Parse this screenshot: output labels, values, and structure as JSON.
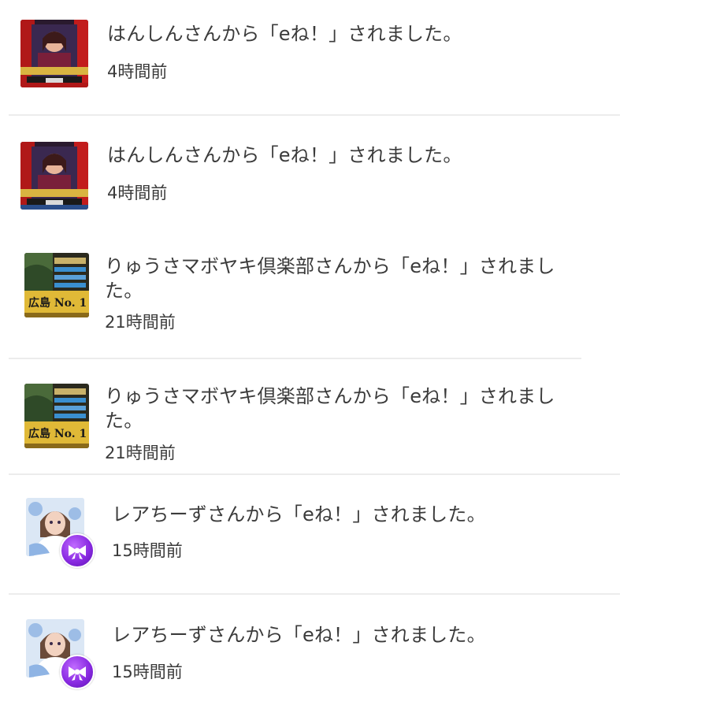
{
  "notifications": [
    {
      "message": "はんしんさんから「eね！」されました。",
      "time": "4時間前",
      "avatar_icon": "character-card-red-icon"
    },
    {
      "message": "はんしんさんから「eね！」されました。",
      "time": "4時間前",
      "avatar_icon": "character-card-red-icon"
    },
    {
      "message": "りゅうさマボヤキ倶楽部さんから「eね！」されました。",
      "time": "21時間前",
      "avatar_icon": "hiroshima-no1-card-icon",
      "avatar_text": "広島 No. 1"
    },
    {
      "message": "りゅうさマボヤキ倶楽部さんから「eね！」されました。",
      "time": "21時間前",
      "avatar_icon": "hiroshima-no1-card-icon",
      "avatar_text": "広島 No. 1"
    },
    {
      "message": "レアちーずさんから「eね！」されました。",
      "time": "15時間前",
      "avatar_icon": "anime-girl-avatar-icon",
      "badge_icon": "ribbon-badge-icon"
    },
    {
      "message": "レアちーずさんから「eね！」されました。",
      "time": "15時間前",
      "avatar_icon": "anime-girl-avatar-icon",
      "badge_icon": "ribbon-badge-icon"
    }
  ],
  "colors": {
    "text": "#3b3b3b",
    "divider": "#ececec",
    "badge": "#8a2be2"
  }
}
